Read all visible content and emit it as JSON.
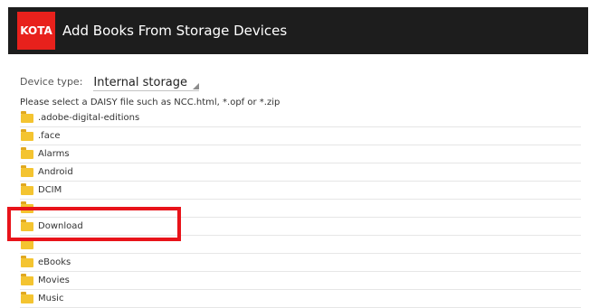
{
  "app_bar": {
    "logo_text": "KOTA",
    "title": "Add Books From Storage Devices",
    "background": "#1d1d1d",
    "logo_color": "#e8211c"
  },
  "device": {
    "label": "Device type:",
    "selected": "Internal storage"
  },
  "instruction": "Please select a DAISY file such as NCC.html, *.opf or *.zip",
  "folders": [
    {
      "label": ".adobe-digital-editions",
      "icon": "folder-icon"
    },
    {
      "label": ".face",
      "icon": "folder-icon"
    },
    {
      "label": "Alarms",
      "icon": "folder-icon"
    },
    {
      "label": "Android",
      "icon": "folder-icon"
    },
    {
      "label": "DCIM",
      "icon": "folder-icon"
    },
    {
      "label": "",
      "icon": "folder-icon"
    },
    {
      "label": "Download",
      "icon": "folder-icon"
    },
    {
      "label": "",
      "icon": "folder-icon"
    },
    {
      "label": "eBooks",
      "icon": "folder-icon"
    },
    {
      "label": "Movies",
      "icon": "folder-icon"
    },
    {
      "label": "Music",
      "icon": "folder-icon"
    }
  ],
  "highlight": {
    "target": "Download",
    "color": "#e8131a"
  }
}
